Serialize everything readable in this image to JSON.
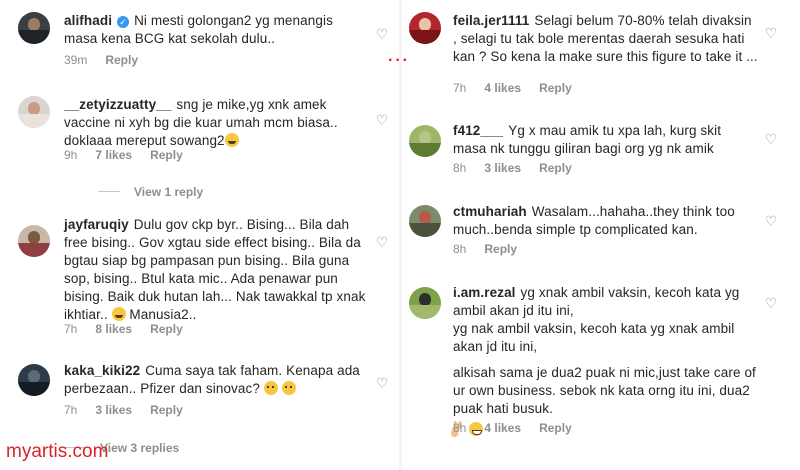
{
  "heart_icon": "heart-outline-icon",
  "watermark": "myartis.com",
  "left": {
    "comments": [
      {
        "username": "alifhadi",
        "verified": true,
        "text": "Ni mesti golongan2 yg menangis masa kena BCG kat sekolah dulu..",
        "time": "39m",
        "likes": "",
        "reply": "Reply"
      },
      {
        "username": "__zetyizzuatty__",
        "text": "sng je mike,yg xnk amek vaccine ni xyh bg die kuar umah mcm biasa.. doklaaa mereput sowang2",
        "emoji": "laugh",
        "time": "9h",
        "likes": "7 likes",
        "reply": "Reply",
        "view_replies": "View 1 reply"
      },
      {
        "username": "jayfaruqiy",
        "text": "Dulu gov ckp byr.. Bising... Bila dah free bising.. Gov xgtau side effect bising.. Bila da bgtau siap bg pampasan pun bising.. Bila guna sop, bising.. Btul kata mic.. Ada penawar pun bising. Baik duk hutan lah... Nak tawakkal tp xnak ikhtiar..",
        "text_after_emoji": " Manusia2..",
        "emoji": "laugh",
        "time": "7h",
        "likes": "8 likes",
        "reply": "Reply"
      },
      {
        "username": "kaka_kiki22",
        "text": "Cuma saya tak faham. Kenapa ada perbezaan.. Pfizer dan sinovac?",
        "emoji": "think",
        "time": "7h",
        "likes": "3 likes",
        "reply": "Reply",
        "view_replies": "View 3 replies"
      }
    ]
  },
  "right": {
    "comments": [
      {
        "username": "feila.jer1111",
        "text": "Selagi belum 70-80% telah divaksin , selagi tu tak bole merentas daerah sesuka hati kan ? So kena la make sure this figure to take it ...",
        "time": "7h",
        "likes": "4 likes",
        "reply": "Reply"
      },
      {
        "username": "f412___",
        "text": "Yg x mau amik tu xpa lah, kurg skit masa nk tunggu giliran bagi org yg nk amik",
        "time": "8h",
        "likes": "3 likes",
        "reply": "Reply"
      },
      {
        "username": "ctmuhariah",
        "text": "Wasalam...hahaha..they think too much..benda simple tp complicated kan.",
        "time": "8h",
        "likes": "",
        "reply": "Reply"
      },
      {
        "username": "i.am.rezal",
        "text": "yg xnak ambil vaksin, kecoh kata yg ambil akan jd itu ini,",
        "text2": "yg nak ambil vaksin, kecoh kata yg xnak ambil akan jd itu ini,",
        "text3": "alkisah sama je dua2 puak ni mic,just take care of ur own business. sebok nk kata orng itu ini, dua2 puak hati busuk.",
        "time": "8h",
        "likes": "4 likes",
        "reply": "Reply"
      }
    ]
  }
}
